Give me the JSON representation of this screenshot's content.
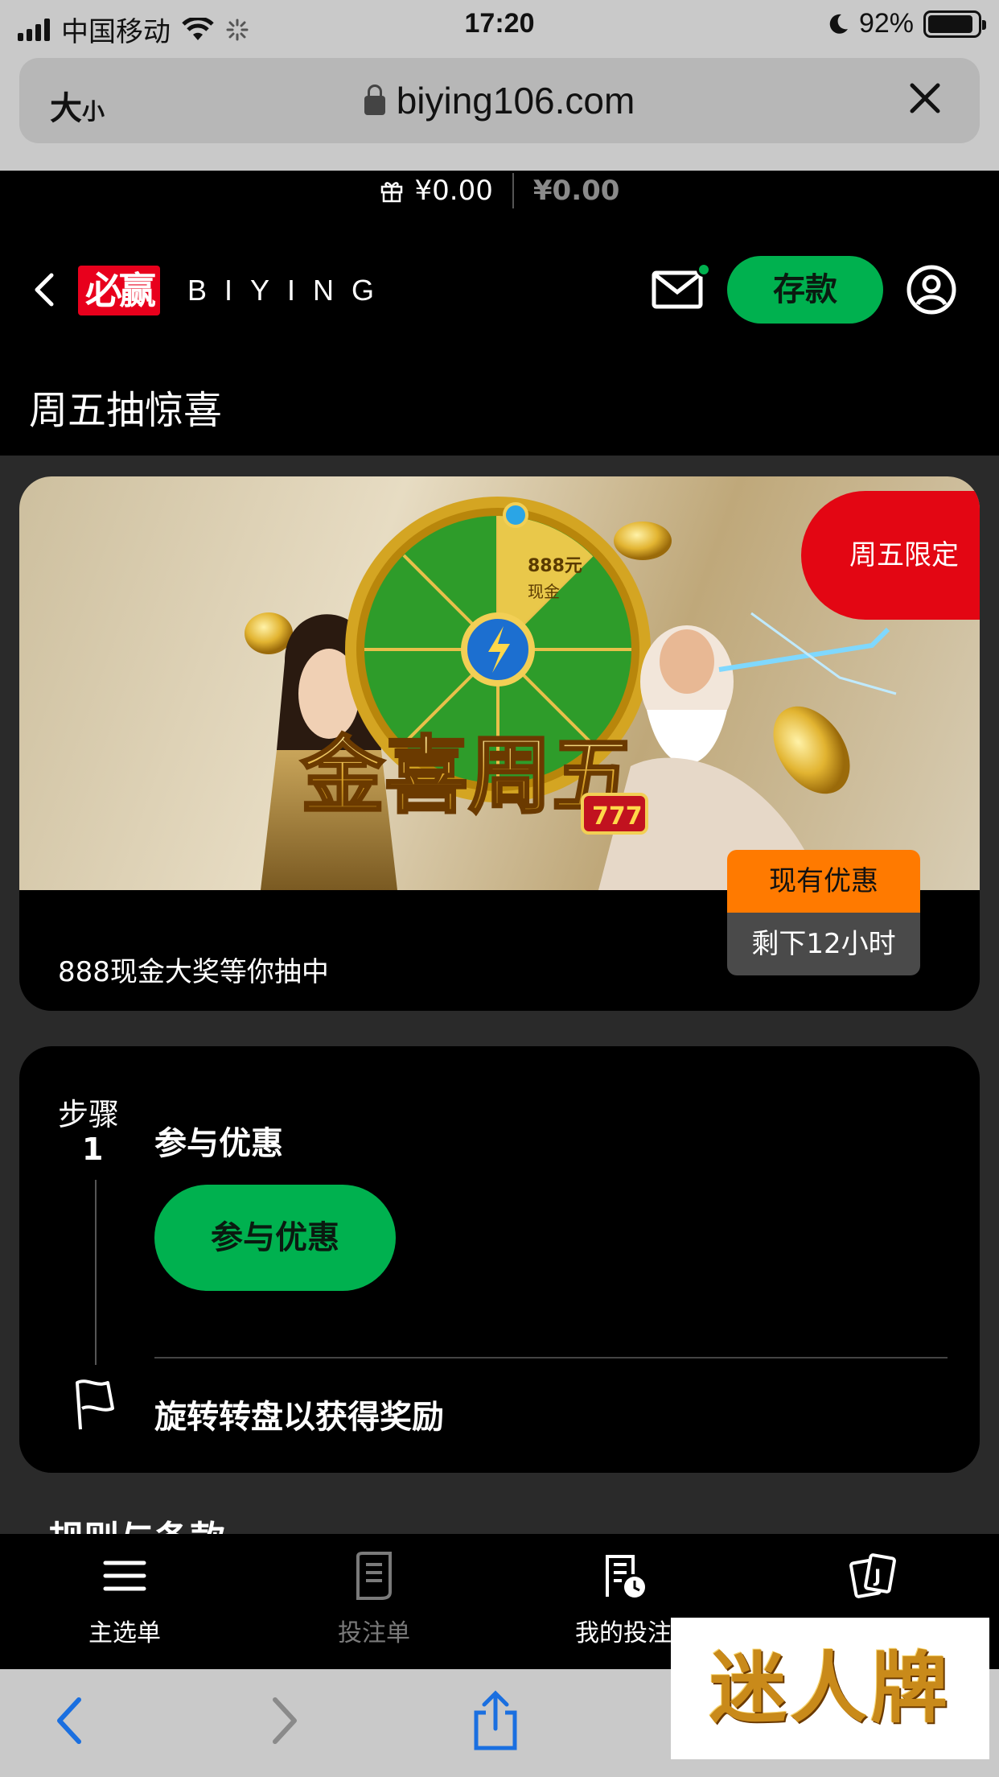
{
  "status_bar": {
    "carrier": "中国移动",
    "time": "17:20",
    "battery": "92%",
    "battery_level": 0.92
  },
  "browser": {
    "text_size_label_big": "大",
    "text_size_label_small": "小",
    "url": "biying106.com"
  },
  "balance": {
    "main": "¥0.00",
    "secondary": "¥0.00"
  },
  "header": {
    "logo_text": "必赢",
    "brand_word": "BIYING",
    "deposit_label": "存款"
  },
  "page_title": "周五抽惊喜",
  "promo": {
    "banner_title": "金喜周五",
    "ribbon": "周五限定",
    "description": "888现金大奖等你抽中",
    "available_tag": "现有优惠",
    "remaining_tag": "剩下12小时",
    "wheel_center": "888元",
    "wheel_center_sub": "现金"
  },
  "steps": {
    "step_label": "步骤",
    "step_number": "1",
    "step_title": "参与优惠",
    "join_button": "参与优惠",
    "final_step": "旋转转盘以获得奖励"
  },
  "rules_heading": "规则与条款",
  "bottom_nav": {
    "menu": "主选单",
    "betslip": "投注单",
    "my_bets": "我的投注"
  },
  "watermark": "迷人牌",
  "colors": {
    "accent_green": "#00b14f",
    "ribbon_red": "#e30613",
    "tag_orange": "#ff7a00"
  }
}
